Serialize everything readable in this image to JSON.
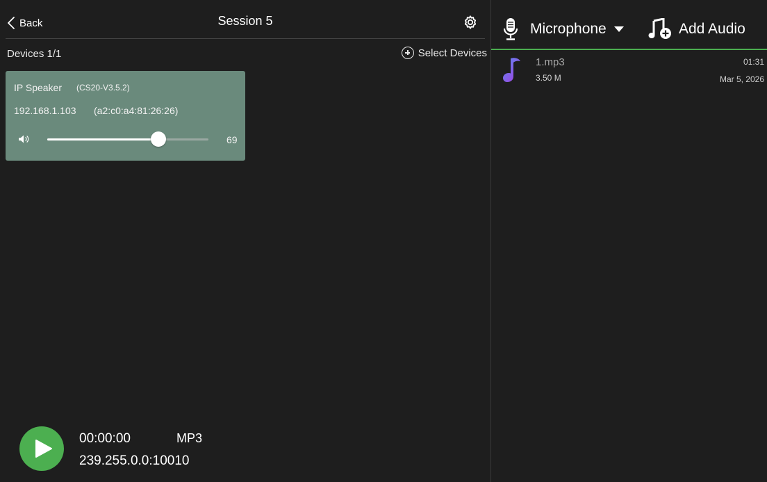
{
  "header": {
    "back_label": "Back",
    "title": "Session 5"
  },
  "devices": {
    "count_label": "Devices 1/1",
    "select_label": "Select Devices",
    "items": [
      {
        "name": "IP Speaker",
        "version": "(CS20-V3.5.2)",
        "ip": "192.168.1.103",
        "mac": "(a2:c0:a4:81:26:26)",
        "volume": 69,
        "volume_fraction": 0.69
      }
    ]
  },
  "player": {
    "time": "00:00:00",
    "format": "MP3",
    "address": "239.255.0.0:10010"
  },
  "source": {
    "input_label": "Microphone",
    "add_audio_label": "Add Audio"
  },
  "audio_list": [
    {
      "name": "1.mp3",
      "size": "3.50 M",
      "duration": "01:31",
      "date": "Mar 5, 2026"
    }
  ],
  "colors": {
    "accent_green": "#4caf50",
    "card_bg": "#6a8a7c",
    "background": "#1e1e1e"
  },
  "icons": [
    "chevron-left-icon",
    "gear-icon",
    "plus-circle-icon",
    "volume-icon",
    "play-icon",
    "microphone-icon",
    "caret-down-icon",
    "music-add-icon",
    "music-note-icon"
  ]
}
